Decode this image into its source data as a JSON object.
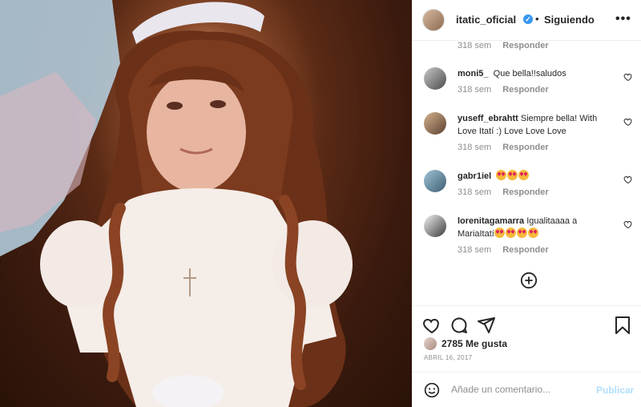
{
  "post": {
    "author": "itatic_oficial",
    "dot": "•",
    "follow_status": "Siguiendo",
    "more_label": "•••",
    "verified_mark": "✓"
  },
  "top_meta": {
    "time": "318 sem",
    "reply": "Responder"
  },
  "comments": [
    {
      "user": "moni5_",
      "text": "Que bella!!saludos",
      "time": "318 sem",
      "reply": "Responder"
    },
    {
      "user": "yuseff_ebrahtt",
      "text": "Siempre bella! With Love Itatí :) Love Love Love",
      "time": "318 sem",
      "reply": "Responder"
    },
    {
      "user": "gabr1iel",
      "text": "",
      "emoji_count": 3,
      "time": "318 sem",
      "reply": "Responder"
    },
    {
      "user": "lorenitagamarra",
      "text": "Igualitaaaa a MariaItatí",
      "emoji_count": 4,
      "time": "318 sem",
      "reply": "Responder"
    }
  ],
  "stats": {
    "likes": "2785 Me gusta",
    "date": "ABRIL 16, 2017"
  },
  "add_comment": {
    "placeholder": "Añade un comentario...",
    "publish": "Publicar"
  },
  "icons": {
    "verified": "verified-badge-icon",
    "more": "more-options-icon",
    "heart": "heart-icon",
    "comment": "comment-icon",
    "share": "share-icon",
    "save": "bookmark-icon",
    "plus": "plus-circle-icon",
    "emoji": "emoji-smile-icon",
    "reaction": "heart-eyes-emoji-icon"
  },
  "colors": {
    "accent": "#3897f0",
    "publish_disabled": "#b2dffc",
    "muted": "#8e8e8e",
    "text": "#262626",
    "divider": "#efefef"
  }
}
